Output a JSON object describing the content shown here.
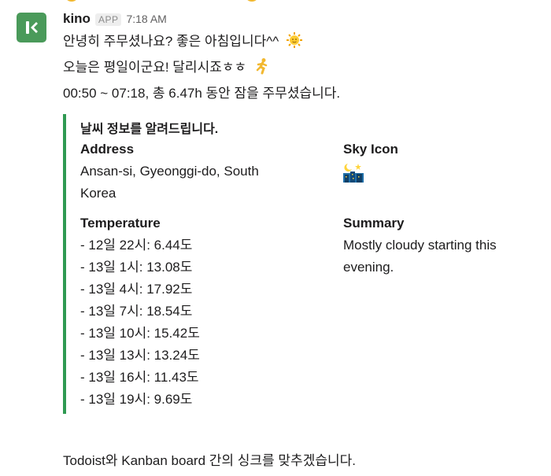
{
  "message": {
    "sender": "kino",
    "badge": "APP",
    "time": "7:18 AM",
    "line1": "안녕히 주무셨나요? 좋은 아침입니다^^",
    "line1_emoji": "sun-with-face-icon",
    "line2": "오늘은 평일이군요! 달리시죠ㅎㅎ",
    "line2_emoji": "runner-icon",
    "line3": "00:50 ~ 07:18, 총 6.47h 동안 잠을 주무셨습니다."
  },
  "attachment": {
    "accent_color": "#2f9a52",
    "title": "날씨 정보를 알려드립니다.",
    "address_label": "Address",
    "address_value": "Ansan-si, Gyeonggi-do, South Korea",
    "sky_icon_label": "Sky Icon",
    "sky_icon": "night-with-stars-icon",
    "temperature_label": "Temperature",
    "temperatures": [
      "- 12일 22시: 6.44도",
      "- 13일 1시: 13.08도",
      "- 13일 4시: 17.92도",
      "- 13일 7시: 18.54도",
      "- 13일 10시: 15.42도",
      "- 13일 13시: 13.24도",
      "- 13일 16시: 11.43도",
      "- 13일 19시: 9.69도"
    ],
    "summary_label": "Summary",
    "summary_value": "Mostly cloudy starting this evening."
  },
  "followup": {
    "text": "Todoist와 Kanban board 간의 싱크를 맞추겠습니다."
  }
}
